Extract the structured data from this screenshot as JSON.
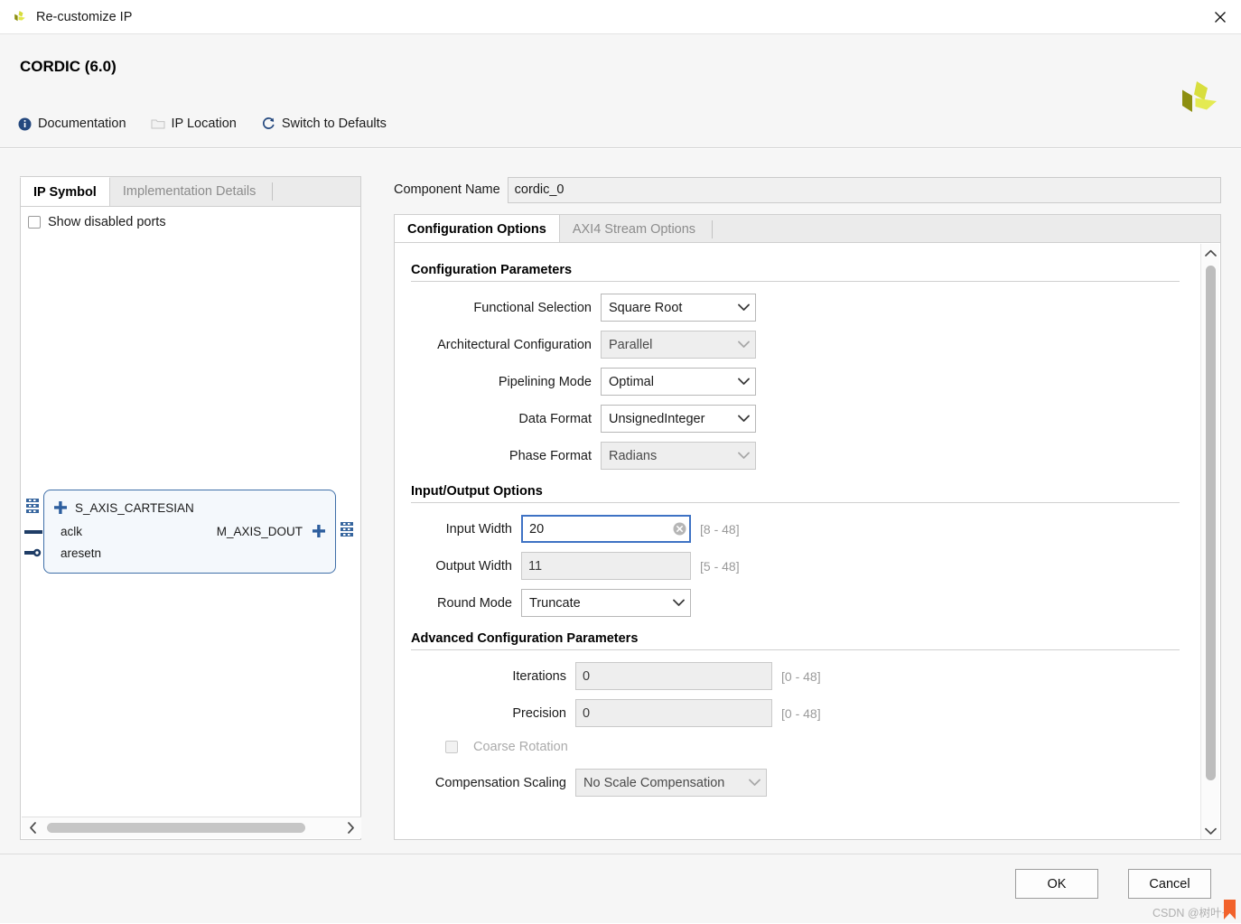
{
  "window": {
    "title": "Re-customize IP",
    "app_icon": "xilinx-logo-icon",
    "close_label": "×"
  },
  "header": {
    "title": "CORDIC (6.0)",
    "logo": "xilinx-logo",
    "toolbar": [
      {
        "label": "Documentation",
        "icon": "info-icon",
        "enabled": true
      },
      {
        "label": "IP Location",
        "icon": "folder-icon",
        "enabled": false
      },
      {
        "label": "Switch to Defaults",
        "icon": "refresh-icon",
        "enabled": true
      }
    ]
  },
  "left_panel": {
    "tabs": [
      {
        "label": "IP Symbol",
        "active": true
      },
      {
        "label": "Implementation Details",
        "active": false
      }
    ],
    "show_disabled_ports": {
      "label": "Show disabled ports",
      "checked": false
    },
    "symbol": {
      "bus_in": "S_AXIS_CARTESIAN",
      "clock": "aclk",
      "reset": "aresetn",
      "bus_out": "M_AXIS_DOUT",
      "expand_in": "+",
      "expand_out": "+"
    }
  },
  "right_panel": {
    "component_name": {
      "label": "Component Name",
      "value": "cordic_0"
    },
    "tabs": [
      {
        "label": "Configuration Options",
        "active": true
      },
      {
        "label": "AXI4 Stream Options",
        "active": false
      }
    ],
    "sections": [
      {
        "heading": "Configuration Parameters",
        "fields": [
          {
            "label": "Functional Selection",
            "type": "combo",
            "value": "Square Root",
            "enabled": true
          },
          {
            "label": "Architectural Configuration",
            "type": "combo",
            "value": "Parallel",
            "enabled": false
          },
          {
            "label": "Pipelining Mode",
            "type": "combo",
            "value": "Optimal",
            "enabled": true
          },
          {
            "label": "Data Format",
            "type": "combo",
            "value": "UnsignedInteger",
            "enabled": true
          },
          {
            "label": "Phase Format",
            "type": "combo",
            "value": "Radians",
            "enabled": false
          }
        ]
      },
      {
        "heading": "Input/Output Options",
        "fields": [
          {
            "label": "Input Width",
            "type": "text",
            "value": "20",
            "range": "[8 - 48]",
            "enabled": true,
            "focused": true,
            "clearable": true
          },
          {
            "label": "Output Width",
            "type": "text",
            "value": "11",
            "range": "[5 - 48]",
            "enabled": false,
            "focused": false,
            "clearable": false
          },
          {
            "label": "Round Mode",
            "type": "combo",
            "value": "Truncate",
            "enabled": true
          }
        ]
      },
      {
        "heading": "Advanced Configuration Parameters",
        "fields": [
          {
            "label": "Iterations",
            "type": "text",
            "value": "0",
            "range": "[0 - 48]",
            "enabled": false,
            "focused": false,
            "clearable": false
          },
          {
            "label": "Precision",
            "type": "text",
            "value": "0",
            "range": "[0 - 48]",
            "enabled": false,
            "focused": false,
            "clearable": false
          },
          {
            "label": "Coarse Rotation",
            "type": "checkbox",
            "value": "",
            "enabled": false,
            "checked": false
          },
          {
            "label": "Compensation Scaling",
            "type": "combo",
            "value": "No Scale Compensation",
            "enabled": false
          }
        ]
      }
    ]
  },
  "footer": {
    "ok_label": "OK",
    "cancel_label": "Cancel"
  },
  "watermark": {
    "text": "CSDN @树叶~"
  },
  "colors": {
    "accent_blue": "#3e72c4",
    "symbol_border": "#3f6fa8",
    "symbol_fill": "#f4f8fc",
    "panel_bg": "#f6f6f6",
    "logo_light": "#d6dc3c",
    "logo_dark": "#8d8f10"
  }
}
